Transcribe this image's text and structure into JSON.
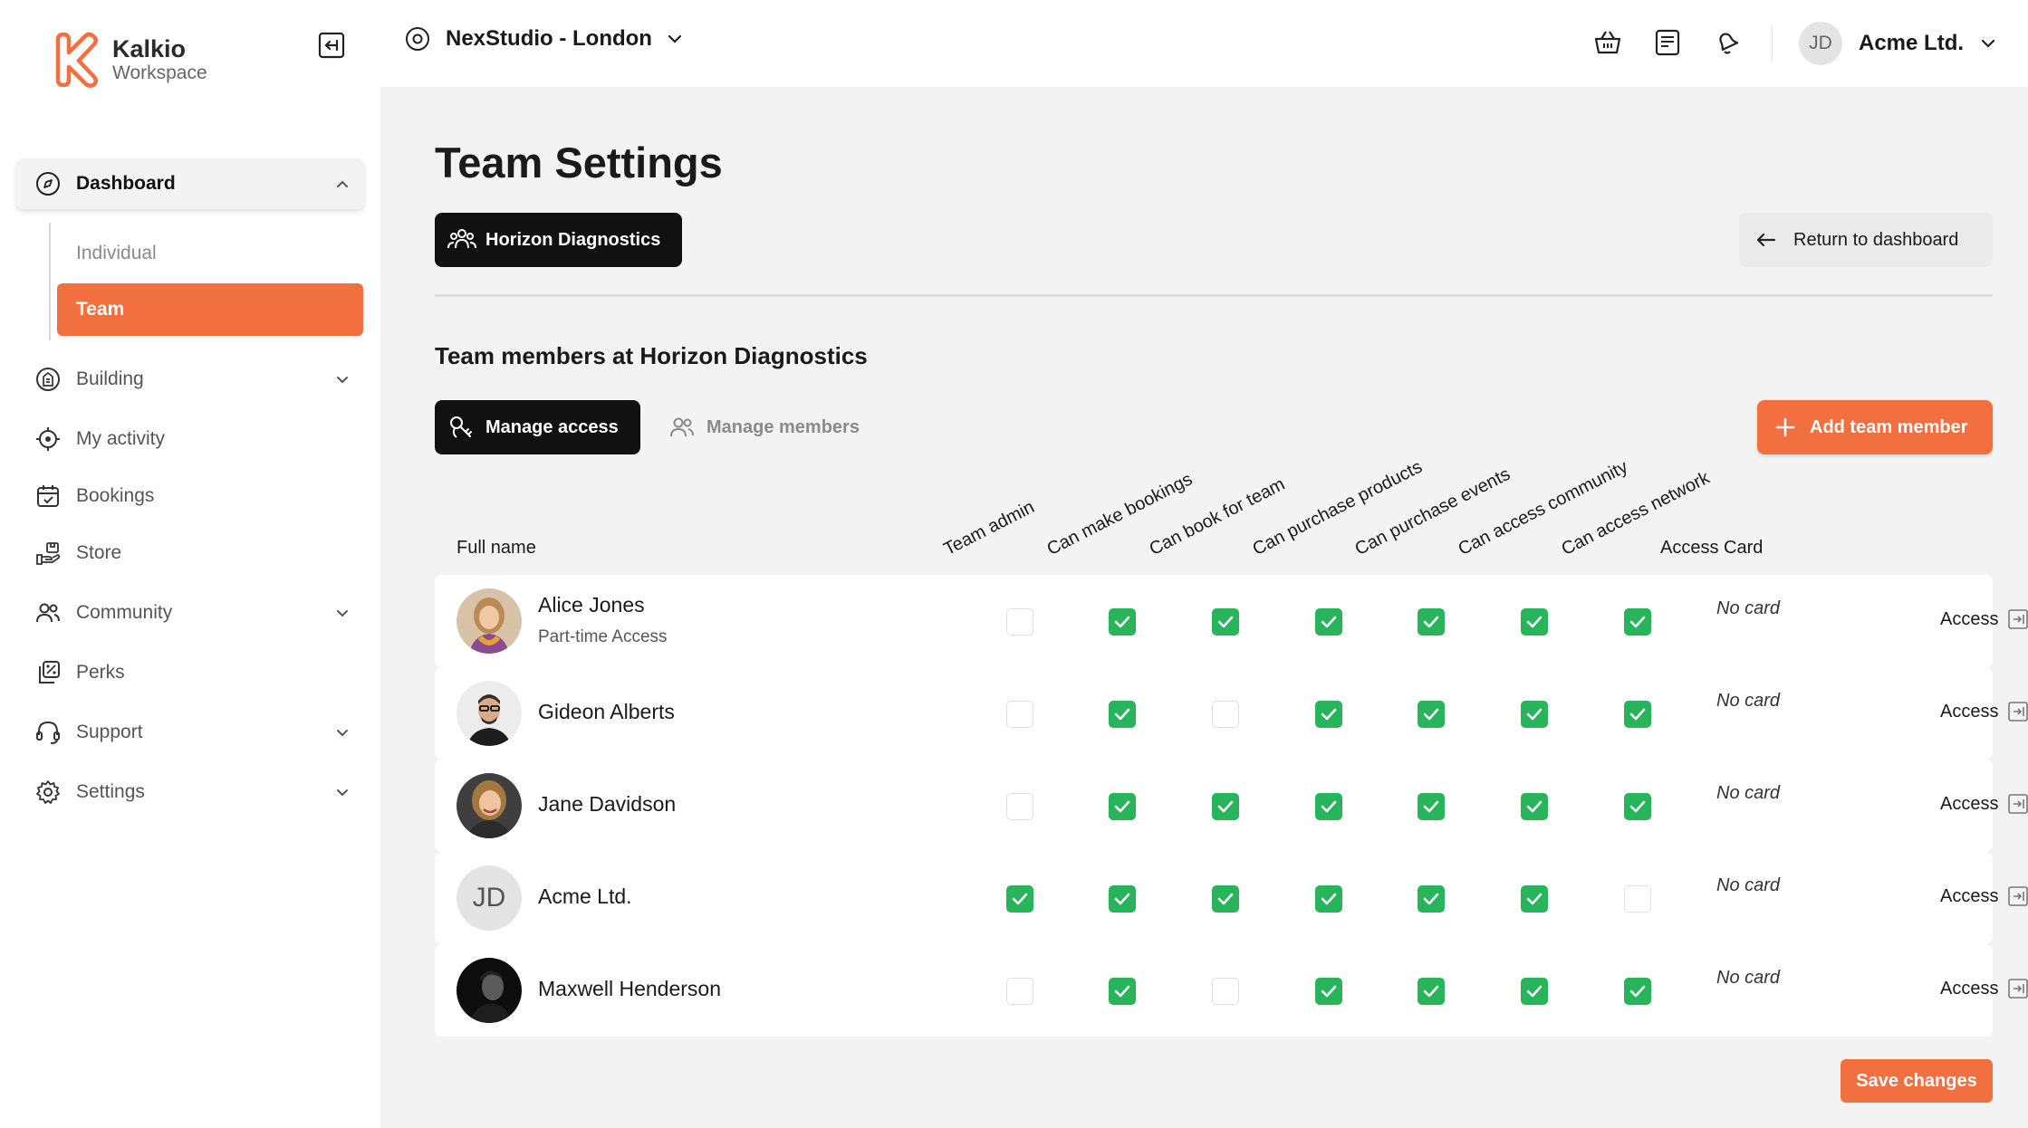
{
  "brand": {
    "name": "Kalkio",
    "sub": "Workspace",
    "color": "#f26f3f"
  },
  "sidebar": {
    "items": [
      {
        "label": "Dashboard",
        "icon": "compass-icon",
        "expanded": true
      },
      {
        "label": "Building",
        "icon": "building-icon",
        "expandable": true
      },
      {
        "label": "My activity",
        "icon": "target-icon"
      },
      {
        "label": "Bookings",
        "icon": "calendar-icon"
      },
      {
        "label": "Store",
        "icon": "store-icon"
      },
      {
        "label": "Community",
        "icon": "users-icon",
        "expandable": true
      },
      {
        "label": "Perks",
        "icon": "perks-icon"
      },
      {
        "label": "Support",
        "icon": "headset-icon",
        "expandable": true
      },
      {
        "label": "Settings",
        "icon": "gear-icon",
        "expandable": true
      }
    ],
    "dashboard_sub": [
      {
        "label": "Individual"
      },
      {
        "label": "Team",
        "selected": true
      }
    ]
  },
  "topbar": {
    "location": "NexStudio - London",
    "account_initials": "JD",
    "account_name": "Acme Ltd."
  },
  "page": {
    "title": "Team Settings",
    "team_chip": "Horizon Diagnostics",
    "return_label": "Return to dashboard",
    "section_title": "Team members at Horizon Diagnostics",
    "tab_manage_access": "Manage access",
    "tab_manage_members": "Manage members",
    "add_member_label": "Add team member",
    "save_label": "Save changes"
  },
  "table": {
    "full_name_header": "Full name",
    "permission_headers": [
      "Team admin",
      "Can make bookings",
      "Can book for team",
      "Can purchase products",
      "Can purchase events",
      "Can access community",
      "Can access network"
    ],
    "access_card_header": "Access Card",
    "rows": [
      {
        "name": "Alice Jones",
        "subtitle": "Part-time Access",
        "avatar": "photo",
        "perms": [
          false,
          true,
          true,
          true,
          true,
          true,
          true
        ],
        "card": "No card",
        "action": "Access"
      },
      {
        "name": "Gideon Alberts",
        "subtitle": "",
        "avatar": "photo",
        "perms": [
          false,
          true,
          false,
          true,
          true,
          true,
          true
        ],
        "card": "No card",
        "action": "Access"
      },
      {
        "name": "Jane Davidson",
        "subtitle": "",
        "avatar": "photo",
        "perms": [
          false,
          true,
          true,
          true,
          true,
          true,
          true
        ],
        "card": "No card",
        "action": "Access"
      },
      {
        "name": "Acme Ltd.",
        "subtitle": "",
        "avatar": "initials",
        "initials": "JD",
        "perms": [
          true,
          true,
          true,
          true,
          true,
          true,
          false
        ],
        "card": "No card",
        "action": "Access"
      },
      {
        "name": "Maxwell Henderson",
        "subtitle": "",
        "avatar": "photo",
        "perms": [
          false,
          true,
          false,
          true,
          true,
          true,
          true
        ],
        "card": "No card",
        "action": "Access"
      }
    ]
  },
  "colors": {
    "accent": "#f26f3f",
    "check": "#27b45a",
    "dark": "#111111",
    "bg": "#f3f3f3"
  }
}
